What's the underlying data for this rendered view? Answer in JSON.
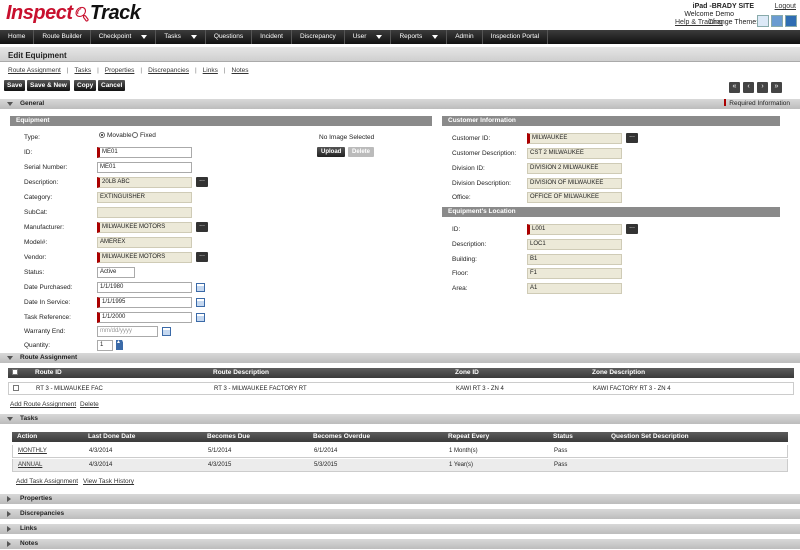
{
  "header": {
    "logo_part1": "Inspect",
    "logo_part2": "Track",
    "site": "iPad -BRADY SITE",
    "logout": "Logout",
    "welcome": "Welcome Demo",
    "help": "Help & Training",
    "change_theme": "Change Theme:",
    "theme_colors": [
      "#dce9f7",
      "#6a9bd1",
      "#2f6db3"
    ]
  },
  "nav": [
    {
      "label": "Home",
      "dropdown": false
    },
    {
      "label": "Route Builder",
      "dropdown": false
    },
    {
      "label": "Checkpoint",
      "dropdown": true
    },
    {
      "label": "Tasks",
      "dropdown": true
    },
    {
      "label": "Questions",
      "dropdown": false
    },
    {
      "label": "Incident",
      "dropdown": false
    },
    {
      "label": "Discrepancy",
      "dropdown": false
    },
    {
      "label": "User",
      "dropdown": true
    },
    {
      "label": "Reports",
      "dropdown": true
    },
    {
      "label": "Admin",
      "dropdown": false
    },
    {
      "label": "Inspection Portal",
      "dropdown": false
    }
  ],
  "page_title": "Edit Equipment",
  "sublinks": [
    "Route Assignment",
    "Tasks",
    "Properties",
    "Discrepancies",
    "Links",
    "Notes"
  ],
  "actions": {
    "save": "Save",
    "save_new": "Save & New",
    "copy": "Copy",
    "cancel": "Cancel"
  },
  "pager": [
    "«",
    "‹",
    "›",
    "»"
  ],
  "general": {
    "title": "General",
    "required": "Required Information",
    "equipment": {
      "title": "Equipment",
      "type_label": "Type:",
      "type_options": [
        "Movable",
        "Fixed"
      ],
      "type_selected": "Movable",
      "no_image": "No Image Selected",
      "upload": "Upload",
      "delete": "Delete",
      "fields": [
        {
          "label": "ID:",
          "value": "ME01"
        },
        {
          "label": "Serial Number:",
          "value": "ME01"
        },
        {
          "label": "Description:",
          "value": "20LB ABC"
        },
        {
          "label": "Category:",
          "value": "EXTINGUISHER"
        },
        {
          "label": "SubCat:",
          "value": ""
        },
        {
          "label": "Manufacturer:",
          "value": "MILWAUKEE MOTORS"
        },
        {
          "label": "Model#:",
          "value": "AMEREX"
        },
        {
          "label": "Vendor:",
          "value": "MILWAUKEE MOTORS"
        },
        {
          "label": "Status:",
          "value": "Active"
        },
        {
          "label": "Date Purchased:",
          "value": "1/1/1980"
        },
        {
          "label": "Date In Service:",
          "value": "1/1/1995"
        },
        {
          "label": "Task Reference:",
          "value": "1/1/2000"
        },
        {
          "label": "Warranty End:",
          "value": "",
          "placeholder": "mm/dd/yyyy"
        },
        {
          "label": "Quantity:",
          "value": "1"
        }
      ]
    },
    "customer": {
      "title": "Customer Information",
      "fields": [
        {
          "label": "Customer ID:",
          "value": "MILWAUKEE"
        },
        {
          "label": "Customer Description:",
          "value": "CST 2 MILWAUKEE"
        },
        {
          "label": "Division ID:",
          "value": "DIVISION 2 MILWAUKEE"
        },
        {
          "label": "Division Description:",
          "value": "DIVISION OF MILWAUKEE"
        },
        {
          "label": "Office:",
          "value": "OFFICE OF MILWAUKEE"
        }
      ]
    },
    "location": {
      "title": "Equipment's Location",
      "fields": [
        {
          "label": "ID:",
          "value": "L001"
        },
        {
          "label": "Description:",
          "value": "LOC1"
        },
        {
          "label": "Building:",
          "value": "B1"
        },
        {
          "label": "Floor:",
          "value": "F1"
        },
        {
          "label": "Area:",
          "value": "A1"
        }
      ]
    }
  },
  "route_assignment": {
    "title": "Route Assignment",
    "columns": [
      "Route ID",
      "Route Description",
      "Zone ID",
      "Zone Description"
    ],
    "rows": [
      [
        "RT 3 - MILWAUKEE FAC",
        "RT 3 - MILWAUKEE FACTORY RT",
        "KAWI RT 3 - ZN 4",
        "KAWI FACTORY RT 3 - ZN 4"
      ]
    ],
    "add": "Add Route Assignment",
    "delete": "Delete"
  },
  "tasks": {
    "title": "Tasks",
    "columns": [
      "Action",
      "Last Done Date",
      "Becomes Due",
      "Becomes Overdue",
      "Repeat Every",
      "Status",
      "Question Set Description"
    ],
    "rows": [
      [
        "MONTHLY",
        "4/3/2014",
        "5/1/2014",
        "6/1/2014",
        "1 Month(s)",
        "Pass",
        ""
      ],
      [
        "ANNUAL",
        "4/3/2014",
        "4/3/2015",
        "5/3/2015",
        "1 Year(s)",
        "Pass",
        ""
      ]
    ],
    "add": "Add Task Assignment",
    "history": "View Task History"
  },
  "collapsed_sections": [
    "Properties",
    "Discrepancies",
    "Links",
    "Notes"
  ]
}
